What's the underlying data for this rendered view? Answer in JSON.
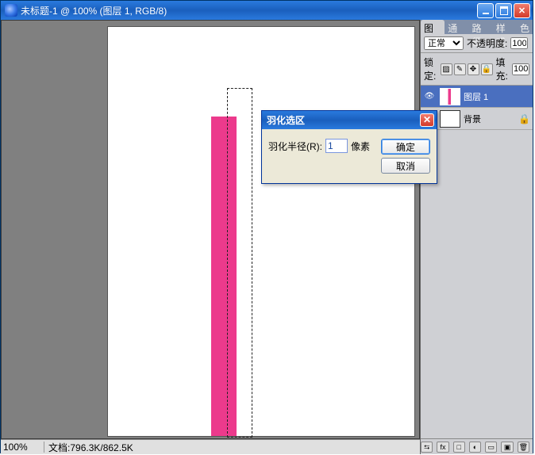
{
  "title_bar": {
    "text": "未标题-1 @ 100% (图层 1, RGB/8)"
  },
  "win_close_glyph": "✕",
  "canvas": {
    "pink_bar_color": "#ec3a8c"
  },
  "status": {
    "zoom": "100%",
    "doc_label": "文档:",
    "doc_info": "796.3K/862.5K"
  },
  "panel": {
    "tabs": [
      "图层",
      "通道",
      "路径",
      "样式",
      "色"
    ],
    "blend_mode": "正常",
    "opacity_label": "不透明度:",
    "opacity_value": "100",
    "lock_label": "锁定:",
    "fill_label": "填充:",
    "fill_value": "100",
    "layers": [
      {
        "name": "图层 1",
        "selected": true
      },
      {
        "name": "背景",
        "selected": false,
        "locked": true
      }
    ]
  },
  "dialog": {
    "title": "羽化选区",
    "field_label": "羽化半径(R):",
    "value": "1",
    "unit": "像素",
    "ok": "确定",
    "cancel": "取消"
  }
}
